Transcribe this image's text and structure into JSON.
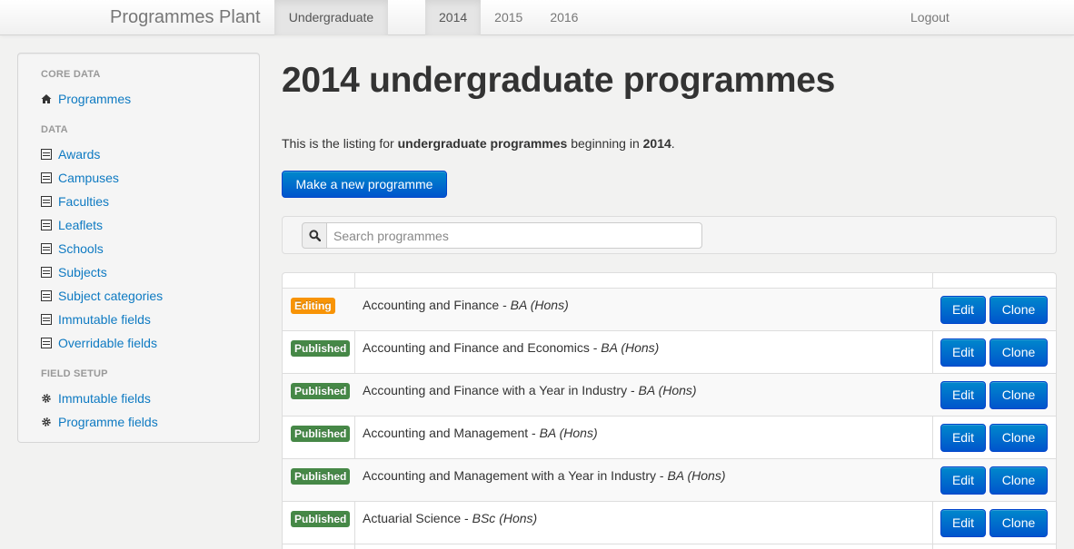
{
  "navbar": {
    "brand": "Programmes Plant",
    "level": "Undergraduate",
    "years": [
      "2014",
      "2015",
      "2016"
    ],
    "active_year": "2014",
    "logout": "Logout"
  },
  "sidebar": {
    "sections": [
      {
        "header": "CORE DATA",
        "items": [
          {
            "label": "Programmes",
            "icon": "home-icon"
          }
        ]
      },
      {
        "header": "DATA",
        "items": [
          {
            "label": "Awards",
            "icon": "list-icon"
          },
          {
            "label": "Campuses",
            "icon": "list-icon"
          },
          {
            "label": "Faculties",
            "icon": "list-icon"
          },
          {
            "label": "Leaflets",
            "icon": "list-icon"
          },
          {
            "label": "Schools",
            "icon": "list-icon"
          },
          {
            "label": "Subjects",
            "icon": "list-icon"
          },
          {
            "label": "Subject categories",
            "icon": "list-icon"
          },
          {
            "label": "Immutable fields",
            "icon": "list-icon"
          },
          {
            "label": "Overridable fields",
            "icon": "list-icon"
          }
        ]
      },
      {
        "header": "FIELD SETUP",
        "items": [
          {
            "label": "Immutable fields",
            "icon": "cog-icon"
          },
          {
            "label": "Programme fields",
            "icon": "cog-icon"
          }
        ]
      }
    ]
  },
  "main": {
    "title": "2014 undergraduate programmes",
    "intro": {
      "prefix": "This is the listing for ",
      "level": "undergraduate programmes",
      "middle": " beginning in ",
      "year": "2014",
      "suffix": "."
    },
    "new_button": "Make a new programme",
    "search": {
      "placeholder": "Search programmes",
      "icon": "search-icon"
    }
  },
  "table": {
    "rows": [
      {
        "status": "Editing",
        "status_color": "#f89406",
        "name": "Accounting and Finance",
        "sep": " - ",
        "award": "BA (Hons)"
      },
      {
        "status": "Published",
        "status_color": "#468847",
        "name": "Accounting and Finance and Economics",
        "sep": " - ",
        "award": "BA (Hons)"
      },
      {
        "status": "Published",
        "status_color": "#468847",
        "name": "Accounting and Finance with a Year in Industry",
        "sep": " - ",
        "award": "BA (Hons)"
      },
      {
        "status": "Published",
        "status_color": "#468847",
        "name": "Accounting and Management",
        "sep": " - ",
        "award": "BA (Hons)"
      },
      {
        "status": "Published",
        "status_color": "#468847",
        "name": "Accounting and Management with a Year in Industry",
        "sep": " - ",
        "award": "BA (Hons)"
      },
      {
        "status": "Published",
        "status_color": "#468847",
        "name": "Actuarial Science",
        "sep": " - ",
        "award": "BSc (Hons)"
      }
    ],
    "edit_label": "Edit",
    "clone_label": "Clone"
  },
  "colors": {
    "link": "#0e7ac2",
    "primary": "#0066cc"
  }
}
